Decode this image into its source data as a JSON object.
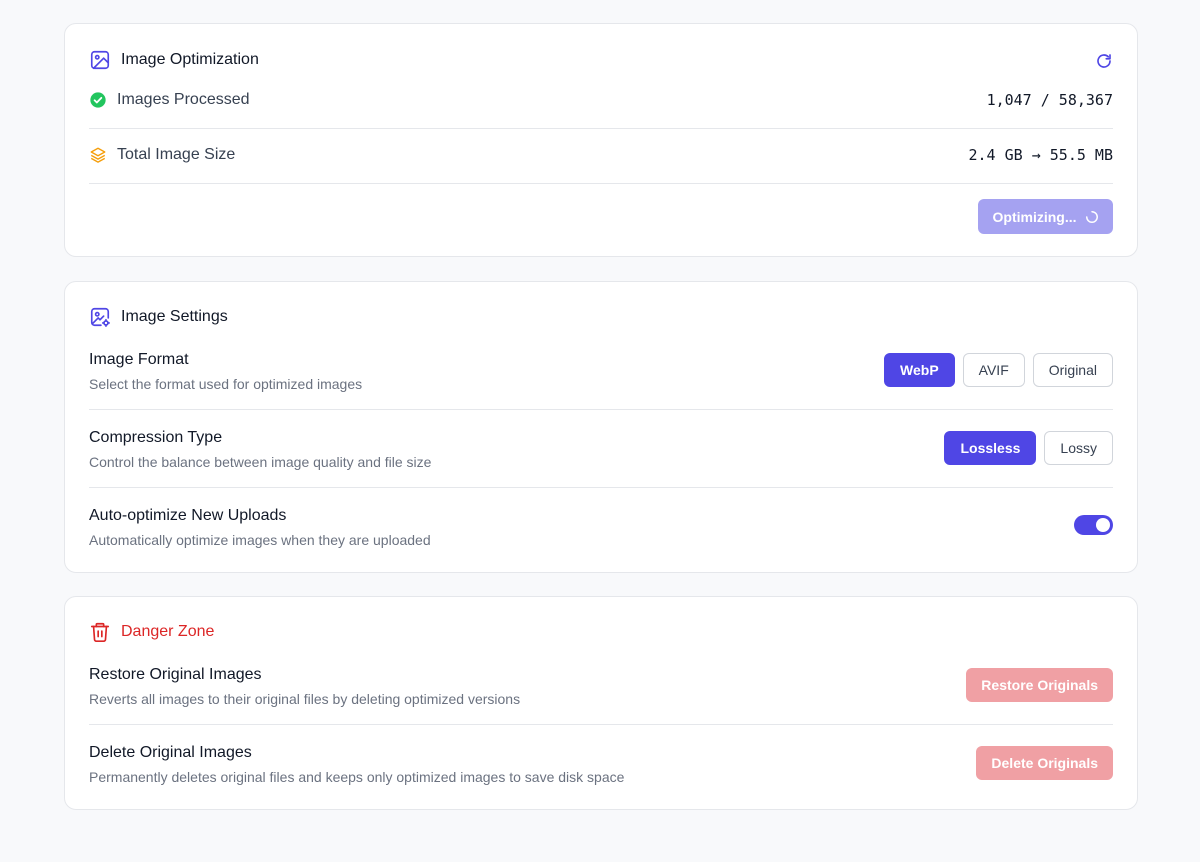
{
  "optimization": {
    "title": "Image Optimization",
    "icons": {
      "header": "image-icon",
      "refresh": "refresh-icon"
    },
    "stats": [
      {
        "label": "Images Processed",
        "value": "1,047 / 58,367",
        "icon": "check-circle-icon",
        "icon_color": "#22c55e"
      },
      {
        "label": "Total Image Size",
        "value": "2.4 GB → 55.5 MB",
        "icon": "layers-icon",
        "icon_color": "#f59e0b"
      }
    ],
    "button_label": "Optimizing..."
  },
  "settings": {
    "title": "Image Settings",
    "icon": "image-settings-icon",
    "image_format": {
      "title": "Image Format",
      "description": "Select the format used for optimized images",
      "options": [
        "WebP",
        "AVIF",
        "Original"
      ],
      "selected": "WebP"
    },
    "compression": {
      "title": "Compression Type",
      "description": "Control the balance between image quality and file size",
      "options": [
        "Lossless",
        "Lossy"
      ],
      "selected": "Lossless"
    },
    "auto_optimize": {
      "title": "Auto-optimize New Uploads",
      "description": "Automatically optimize images when they are uploaded",
      "enabled": true
    }
  },
  "danger": {
    "title": "Danger Zone",
    "icon": "trash-icon",
    "restore": {
      "title": "Restore Original Images",
      "description": "Reverts all images to their original files by deleting optimized versions",
      "button_label": "Restore Originals"
    },
    "delete": {
      "title": "Delete Original Images",
      "description": "Permanently deletes original files and keeps only optimized images to save disk space",
      "button_label": "Delete Originals"
    }
  },
  "colors": {
    "accent": "#4f46e5",
    "accent_disabled": "#a5a2f1",
    "danger": "#dc2626",
    "danger_disabled": "#f0a0a4",
    "success": "#22c55e",
    "warning": "#f59e0b"
  }
}
